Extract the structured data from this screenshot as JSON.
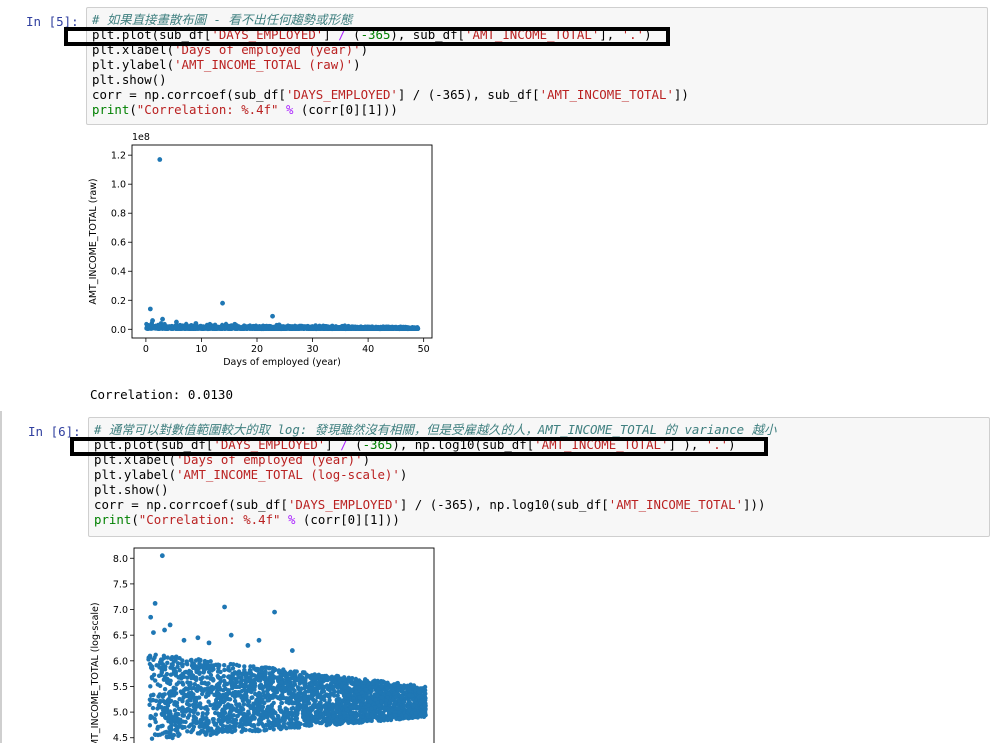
{
  "cells": [
    {
      "prompt": "In [5]:",
      "comment": "# 如果直接畫散布圖 - 看不出任何趨勢或形態",
      "lines": {
        "l1": {
          "a": "plt.plot(sub_df[",
          "s1": "'DAYS_EMPLOYED'",
          "b": "] ",
          "op": "/",
          "c": " (",
          "n": "-365",
          "d": "), sub_df[",
          "s2": "'AMT_INCOME_TOTAL'",
          "e": "], ",
          "s3": "'.'",
          "f": ")"
        },
        "l2": {
          "a": "plt.xlabel(",
          "s": "'Days of employed (year)'",
          "b": ")"
        },
        "l3": {
          "a": "plt.ylabel(",
          "s": "'AMT_INCOME_TOTAL (raw)'",
          "b": ")"
        },
        "l4": "plt.show()",
        "l5": {
          "a": "corr = np.corrcoef(sub_df[",
          "s1": "'DAYS_EMPLOYED'",
          "b": "] / (-365), sub_df[",
          "s2": "'AMT_INCOME_TOTAL'",
          "c": "])"
        },
        "l6": {
          "kw": "print",
          "a": "(",
          "s": "\"Correlation: %.4f\"",
          "op": " %",
          "b": " (corr[0][1]))"
        }
      },
      "output": "Correlation: 0.0130"
    },
    {
      "prompt": "In [6]:",
      "comment": "# 通常可以對數值範圍較大的取 log: 發現雖然沒有相關，但是受雇越久的人，AMT_INCOME_TOTAL 的 variance 越小",
      "lines": {
        "l1": {
          "a": "plt.plot(sub_df[",
          "s1": "'DAYS_EMPLOYED'",
          "b": "] ",
          "op": "/",
          "c": " (",
          "n": "-365",
          "d": "), np.log10(sub_df[",
          "s2": "'AMT_INCOME_TOTAL'",
          "e": "] ), ",
          "s3": "'.'",
          "f": ")"
        },
        "l2": {
          "a": "plt.xlabel(",
          "s": "'Days of employed (year)'",
          "b": ")"
        },
        "l3": {
          "a": "plt.ylabel(",
          "s": "'AMT_INCOME_TOTAL (log-scale)'",
          "b": ")"
        },
        "l4": "plt.show()",
        "l5": {
          "a": "corr = np.corrcoef(sub_df[",
          "s1": "'DAYS_EMPLOYED'",
          "b": "] / (-365), np.log10(sub_df[",
          "s2": "'AMT_INCOME_TOTAL'",
          "c": "]))"
        },
        "l6": {
          "kw": "print",
          "a": "(",
          "s": "\"Correlation: %.4f\"",
          "op": " %",
          "b": " (corr[0][1]))"
        }
      }
    }
  ],
  "chart_data": [
    {
      "type": "scatter",
      "xlabel": "Days of employed (year)",
      "ylabel": "AMT_INCOME_TOTAL (raw)",
      "offset_label": "1e8",
      "xlim": [
        -2.5,
        51.5
      ],
      "ylim": [
        -0.06,
        1.27
      ],
      "xticks": [
        0,
        10,
        20,
        30,
        40,
        50
      ],
      "yticks": [
        0.0,
        0.2,
        0.4,
        0.6,
        0.8,
        1.0,
        1.2
      ],
      "ytick_labels": [
        "0.0",
        "0.2",
        "0.4",
        "0.6",
        "0.8",
        "1.0",
        "1.2"
      ],
      "color": "#1f77b4",
      "band": {
        "x_range": [
          0,
          49
        ],
        "y_center": 0.003,
        "y_spread": 0.012
      },
      "outliers": [
        [
          2.5,
          1.17
        ],
        [
          13.8,
          0.18
        ],
        [
          0.8,
          0.14
        ],
        [
          22.8,
          0.09
        ],
        [
          1.2,
          0.06
        ],
        [
          5.5,
          0.05
        ],
        [
          9.0,
          0.04
        ],
        [
          16.0,
          0.035
        ],
        [
          3.0,
          0.07
        ],
        [
          24.0,
          0.03
        ]
      ]
    },
    {
      "type": "scatter",
      "xlabel": "Days of employed (year)",
      "ylabel": "AMT_INCOME_TOTAL (log-scale)",
      "xlim": [
        -2.5,
        51.5
      ],
      "ylim": [
        4.3,
        8.2
      ],
      "yticks": [
        4.5,
        5.0,
        5.5,
        6.0,
        6.5,
        7.0,
        7.5,
        8.0
      ],
      "ytick_labels": [
        "4.5",
        "5.0",
        "5.5",
        "6.0",
        "6.5",
        "7.0",
        "7.5",
        "8.0"
      ],
      "color": "#1f77b4",
      "band": {
        "x_range": [
          0,
          50
        ],
        "y_low_start": 4.45,
        "y_high_start": 6.15,
        "y_low_end": 4.9,
        "y_high_end": 5.5
      },
      "outliers": [
        [
          2.6,
          8.05
        ],
        [
          1.3,
          7.12
        ],
        [
          13.8,
          7.05
        ],
        [
          22.8,
          6.95
        ],
        [
          4.0,
          6.7
        ],
        [
          0.5,
          6.85
        ],
        [
          3.0,
          6.6
        ],
        [
          15.0,
          6.5
        ],
        [
          9.0,
          6.45
        ],
        [
          20.0,
          6.4
        ],
        [
          6.5,
          6.4
        ],
        [
          1.0,
          6.55
        ],
        [
          11.0,
          6.35
        ],
        [
          18.0,
          6.3
        ],
        [
          26.0,
          6.2
        ]
      ]
    }
  ]
}
